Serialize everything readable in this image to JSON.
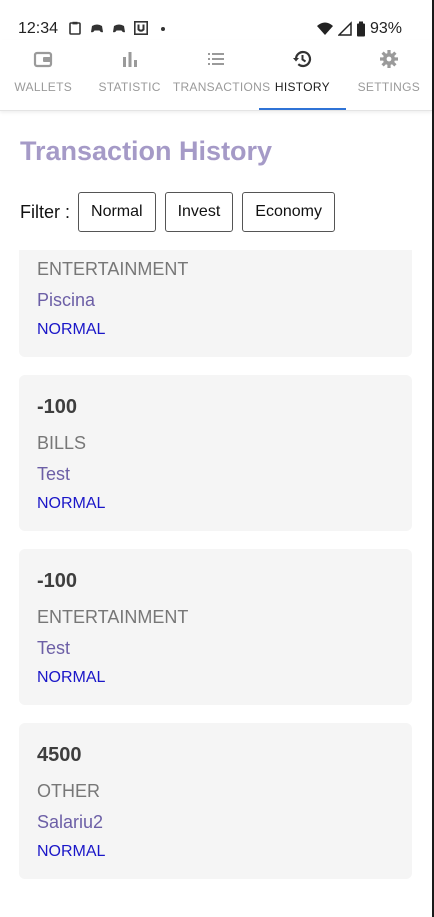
{
  "status_bar": {
    "time": "12:34",
    "battery": "93%"
  },
  "tabs": [
    {
      "label": "WALLETS",
      "icon": "wallet-icon",
      "active": false
    },
    {
      "label": "STATISTIC",
      "icon": "bar-chart-icon",
      "active": false
    },
    {
      "label": "TRANSACTIONS",
      "icon": "list-icon",
      "active": false
    },
    {
      "label": "HISTORY",
      "icon": "history-icon",
      "active": true
    },
    {
      "label": "SETTINGS",
      "icon": "gear-icon",
      "active": false
    }
  ],
  "page": {
    "title": "Transaction History",
    "filter_label": "Filter :",
    "filters": [
      "Normal",
      "Invest",
      "Economy"
    ]
  },
  "transactions": [
    {
      "amount": "",
      "category": "ENTERTAINMENT",
      "description": "Piscina",
      "type": "NORMAL"
    },
    {
      "amount": "-100",
      "category": "BILLS",
      "description": "Test",
      "type": "NORMAL"
    },
    {
      "amount": "-100",
      "category": "ENTERTAINMENT",
      "description": "Test",
      "type": "NORMAL"
    },
    {
      "amount": "4500",
      "category": "OTHER",
      "description": "Salariu2",
      "type": "NORMAL"
    }
  ],
  "colors": {
    "title": "#a59ac7",
    "description": "#6c5fa6",
    "type": "#1a16c8",
    "active_tab_underline": "#2f73d6",
    "card_bg": "#f5f5f5"
  }
}
